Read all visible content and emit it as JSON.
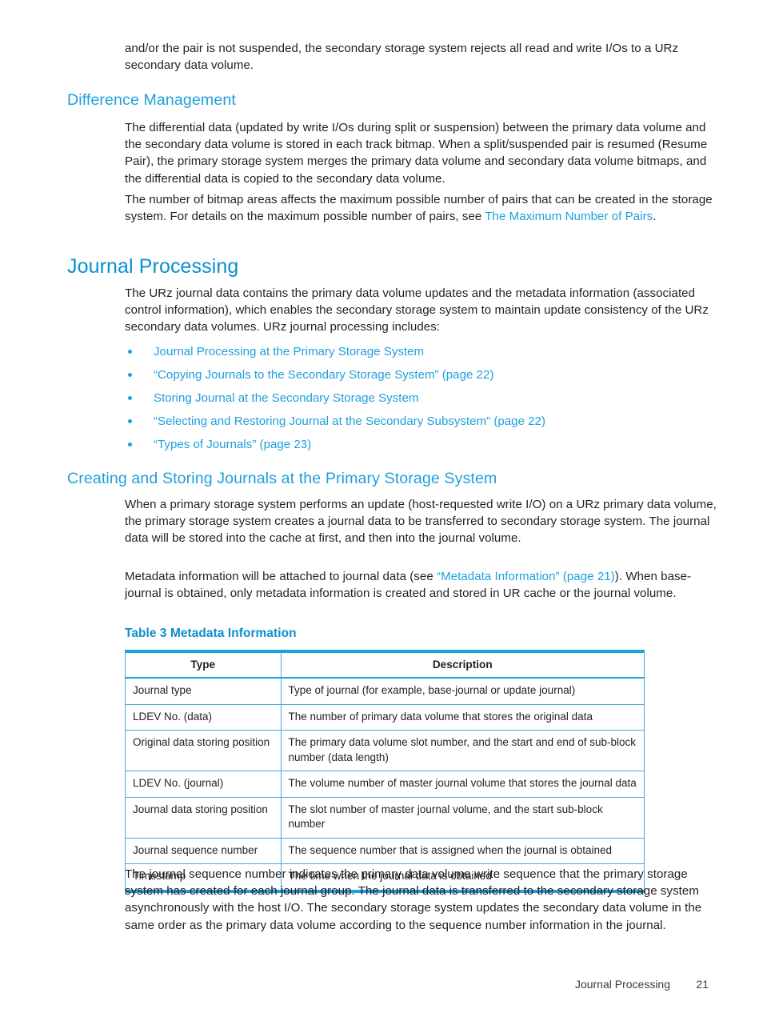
{
  "document": {
    "accent_blue": "#1fa0dd",
    "heading_blue": "#0b8fd0",
    "body_color": "#231f20"
  },
  "intro_paragraph": {
    "text": "and/or the pair is not suspended, the secondary storage system rejects all read and write I/Os to a URz secondary data volume."
  },
  "difference_management": {
    "heading": "Difference Management",
    "paragraph_1": "The differential data (updated by write I/Os during split or suspension) between the primary data volume and the secondary data volume is stored in each track bitmap. When a split/suspended pair is resumed (Resume Pair), the primary storage system merges the primary data volume and secondary data volume bitmaps, and the differential data is copied to the secondary data volume.",
    "paragraph_2_before": "The number of bitmap areas affects the maximum possible number of pairs that can be created in the storage system. For details on the maximum possible number of pairs, see ",
    "paragraph_2_link": "The Maximum Number of Pairs",
    "paragraph_2_after": "."
  },
  "journal_processing": {
    "heading": "Journal Processing",
    "paragraph_1": "The URz journal data contains the primary data volume updates and the metadata information (associated control information), which enables the secondary storage system to maintain update consistency of the URz secondary data volumes. URz journal processing includes:",
    "bullets": [
      {
        "label": "Journal Processing at the Primary Storage System"
      },
      {
        "label": "“Copying Journals to the Secondary Storage System” (page 22)"
      },
      {
        "label": "Storing Journal at the Secondary Storage System"
      },
      {
        "label": "“Selecting and Restoring Journal at the Secondary Subsystem” (page 22)"
      },
      {
        "label": "“Types of Journals” (page 23)"
      }
    ]
  },
  "creating_storing": {
    "heading": "Creating and Storing Journals at the Primary Storage System",
    "paragraph_1": "When a primary storage system performs an update (host-requested write I/O) on a URz primary data volume, the primary storage system creates a journal data to be transferred to secondary storage system. The journal data will be stored into the cache at first, and then into the journal volume.",
    "paragraph_2_before": "Metadata information will be attached to journal data (see ",
    "paragraph_2_link": "“Metadata Information” (page 21)",
    "paragraph_2_after": "). When base-journal is obtained, only metadata information is created and stored in UR cache or the journal volume."
  },
  "table": {
    "caption": "Table 3 Metadata Information",
    "headers": [
      "Type",
      "Description"
    ],
    "rows": [
      {
        "type": "Journal type",
        "description": "Type of journal (for example, base-journal or update journal)"
      },
      {
        "type": "LDEV No. (data)",
        "description": "The number of primary data volume that stores the original data"
      },
      {
        "type": "Original data storing position",
        "description": "The primary data volume slot number, and the start and end of sub-block number (data length)"
      },
      {
        "type": "LDEV No. (journal)",
        "description": "The volume number of master journal volume that stores the journal data"
      },
      {
        "type": "Journal data storing position",
        "description": "The slot number of master journal volume, and the start sub-block number"
      },
      {
        "type": "Journal sequence number",
        "description": "The sequence number that is assigned when the journal is obtained"
      },
      {
        "type": "Timestamp",
        "description": "The time when the journal data is obtained"
      }
    ]
  },
  "closing_paragraph": {
    "text": "The journal sequence number indicates the primary data volume write sequence that the primary storage system has created for each journal group. The journal data is transferred to the secondary storage system asynchronously with the host I/O. The secondary storage system updates the secondary data volume in the same order as the primary data volume according to the sequence number information in the journal."
  },
  "footer": {
    "section": "Journal Processing",
    "page_number": "21"
  }
}
